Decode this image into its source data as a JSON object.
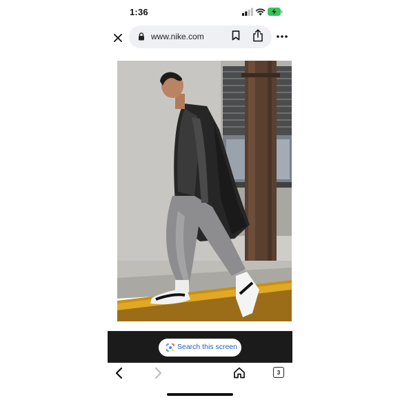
{
  "status_bar": {
    "time": "1:36",
    "icons": [
      "signal-icon",
      "wifi-icon",
      "battery-charging-icon"
    ],
    "battery_color": "#34c759"
  },
  "browser": {
    "url": "www.nike.com",
    "icons": [
      "close-icon",
      "lock-icon",
      "bookmark-icon",
      "share-icon",
      "more-icon"
    ]
  },
  "hero": {
    "description_icon": "product-photo"
  },
  "lens_bar": {
    "button_label": "Search this screen",
    "accent": "#1a5fc8"
  },
  "nav": {
    "tab_count": "3",
    "icons": [
      "back-icon",
      "forward-icon",
      "home-icon",
      "tabs-icon"
    ]
  }
}
